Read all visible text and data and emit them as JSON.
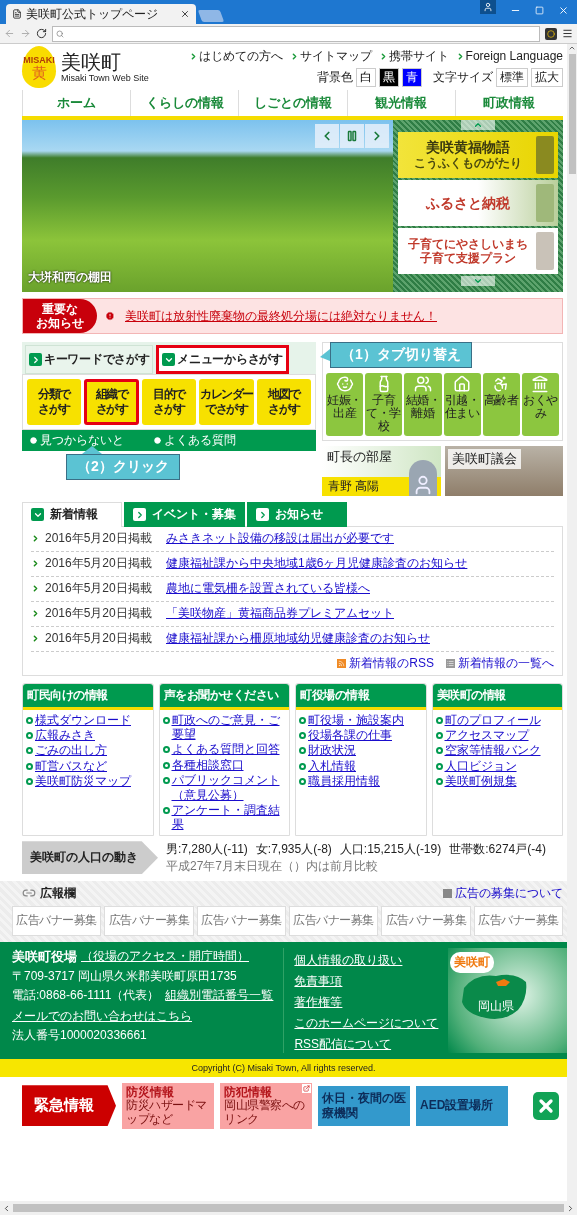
{
  "browser": {
    "tab_title": "美咲町公式トップページ"
  },
  "logo": {
    "badge_text": "MISAKI",
    "badge_char": "黄",
    "name": "美咲町",
    "subtitle": "Misaki Town Web Site"
  },
  "header_links": [
    "はじめての方へ",
    "サイトマップ",
    "携帯サイト",
    "Foreign Language"
  ],
  "background_color": {
    "label": "背景色",
    "options": [
      {
        "label": "白",
        "color": "#ffffff"
      },
      {
        "label": "黒",
        "color": "#000000"
      },
      {
        "label": "青",
        "color": "#0000ff"
      }
    ]
  },
  "font_size": {
    "label": "文字サイズ",
    "options": [
      "標準",
      "拡大"
    ]
  },
  "nav": [
    "ホーム",
    "くらしの情報",
    "しごとの情報",
    "観光情報",
    "町政情報"
  ],
  "hero": {
    "caption": "大垪和西の棚田",
    "banners": [
      {
        "kind": "story",
        "title": "美咲黄福物語",
        "subtitle": "こうふくものがたり"
      },
      {
        "kind": "tax",
        "title": "ふるさと納税"
      },
      {
        "kind": "support",
        "subtitle": "子育てにやさしいまち",
        "title": "子育て支援プラン"
      }
    ]
  },
  "notice": {
    "label_lines": [
      "重要な",
      "お知らせ"
    ],
    "text": "美咲町は放射性廃棄物の最終処分場には絶対なりません！"
  },
  "search": {
    "tabs": [
      {
        "label": "キーワードでさがす",
        "selected": false,
        "highlighted": false
      },
      {
        "label": "メニューからさがす",
        "selected": true,
        "highlighted": true
      }
    ],
    "buttons": [
      {
        "lines": [
          "分類で",
          "さがす"
        ],
        "highlighted": false
      },
      {
        "lines": [
          "組織で",
          "さがす"
        ],
        "highlighted": true
      },
      {
        "lines": [
          "目的で",
          "さがす"
        ],
        "highlighted": false
      },
      {
        "lines": [
          "カレンダー",
          "でさがす"
        ],
        "highlighted": false
      },
      {
        "lines": [
          "地図で",
          "さがす"
        ],
        "highlighted": false
      }
    ],
    "links": [
      "見つからないと",
      "よくある質問"
    ]
  },
  "annotations": [
    {
      "kind": "tab",
      "text": "（1）タブ切り替え"
    },
    {
      "kind": "button",
      "text": "（2）クリック"
    }
  ],
  "life_events": [
    {
      "kind": "baby",
      "label": "妊娠・出産"
    },
    {
      "kind": "bottle",
      "label": "子育て・学校"
    },
    {
      "kind": "couple",
      "label": "結婚・離婚"
    },
    {
      "kind": "house",
      "label": "引越・住まい"
    },
    {
      "kind": "wheelchair",
      "label": "高齢者"
    },
    {
      "kind": "memorial",
      "label": "おくやみ"
    }
  ],
  "feature_banners": [
    {
      "kind": "mayor",
      "title": "町長の部屋",
      "name": "青野 高陽"
    },
    {
      "kind": "council",
      "title": "美咲町議会"
    }
  ],
  "news": {
    "tabs": [
      {
        "label": "新着情報",
        "selected": true
      },
      {
        "label": "イベント・募集",
        "selected": false
      },
      {
        "label": "お知らせ",
        "selected": false
      }
    ],
    "items": [
      {
        "date": "2016年5月20日掲載",
        "title": "みさきネット設備の移設は届出が必要です"
      },
      {
        "date": "2016年5月20日掲載",
        "title": "健康福祉課から中央地域1歳6ヶ月児健康診査のお知らせ"
      },
      {
        "date": "2016年5月20日掲載",
        "title": "農地に電気柵を設置されている皆様へ"
      },
      {
        "date": "2016年5月20日掲載",
        "title": "「美咲物産」黄福商品券プレミアムセット"
      },
      {
        "date": "2016年5月20日掲載",
        "title": "健康福祉課から柵原地域幼児健康診査のお知らせ"
      }
    ],
    "links": [
      {
        "kind": "rss",
        "label": "新着情報のRSS"
      },
      {
        "kind": "list",
        "label": "新着情報の一覧へ"
      }
    ]
  },
  "info_boxes": [
    {
      "title": "町民向けの情報",
      "links": [
        "様式ダウンロード",
        "広報みさき",
        "ごみの出し方",
        "町営バスなど",
        "美咲町防災マップ"
      ]
    },
    {
      "title": "声をお聞かせください",
      "links": [
        "町政へのご意見・ご要望",
        "よくある質問と回答",
        "各種相談窓口",
        "パブリックコメント（意見公募）",
        "アンケート・調査結果"
      ]
    },
    {
      "title": "町役場の情報",
      "links": [
        "町役場・施設案内",
        "役場各課の仕事",
        "財政状況",
        "入札情報",
        "職員採用情報"
      ]
    },
    {
      "title": "美咲町の情報",
      "links": [
        "町のプロフィール",
        "アクセスマップ",
        "空家等情報バンク",
        "人口ビジョン",
        "美咲町例規集"
      ]
    }
  ],
  "population": {
    "label": "美咲町の人口の動き",
    "stats": [
      "男:7,280人(-11)",
      "女:7,935人(-8)",
      "人口:15,215人(-19)",
      "世帯数:6274戸(-4)"
    ],
    "note": "平成27年7月末日現在（）内は前月比較"
  },
  "ads": {
    "title": "広報欄",
    "link": "広告の募集について",
    "banners": [
      "広告バナー募集",
      "広告バナー募集",
      "広告バナー募集",
      "広告バナー募集",
      "広告バナー募集",
      "広告バナー募集"
    ]
  },
  "footer": {
    "office": "美咲町役場",
    "office_link": "（役場のアクセス・開庁時間）",
    "address": "〒709-3717 岡山県久米郡美咲町原田1735",
    "phone": "電話:0868-66-1111（代表）",
    "phone_link": "組織別電話番号一覧",
    "mail_link": "メールでのお問い合わせはこちら",
    "corporate_number": "法人番号1000020336661",
    "links": [
      "個人情報の取り扱い",
      "免責事項",
      "著作権等",
      "このホームページについて",
      "RSS配信について"
    ],
    "map": {
      "town": "美咲町",
      "prefecture": "岡山県"
    }
  },
  "copyright": "Copyright (C) Misaki Town, All rights reserved.",
  "emergency": {
    "label": "緊急情報",
    "items": [
      {
        "kind": "alert",
        "title": "防災情報",
        "subtitle": "防災ハザードマップなど",
        "external": false
      },
      {
        "kind": "alert",
        "title": "防犯情報",
        "subtitle": "岡山県警察へのリンク",
        "external": true
      },
      {
        "kind": "info",
        "title": "休日・夜間の医療機関",
        "external": false
      },
      {
        "kind": "info",
        "title": "AED設置場所",
        "external": false
      }
    ]
  }
}
